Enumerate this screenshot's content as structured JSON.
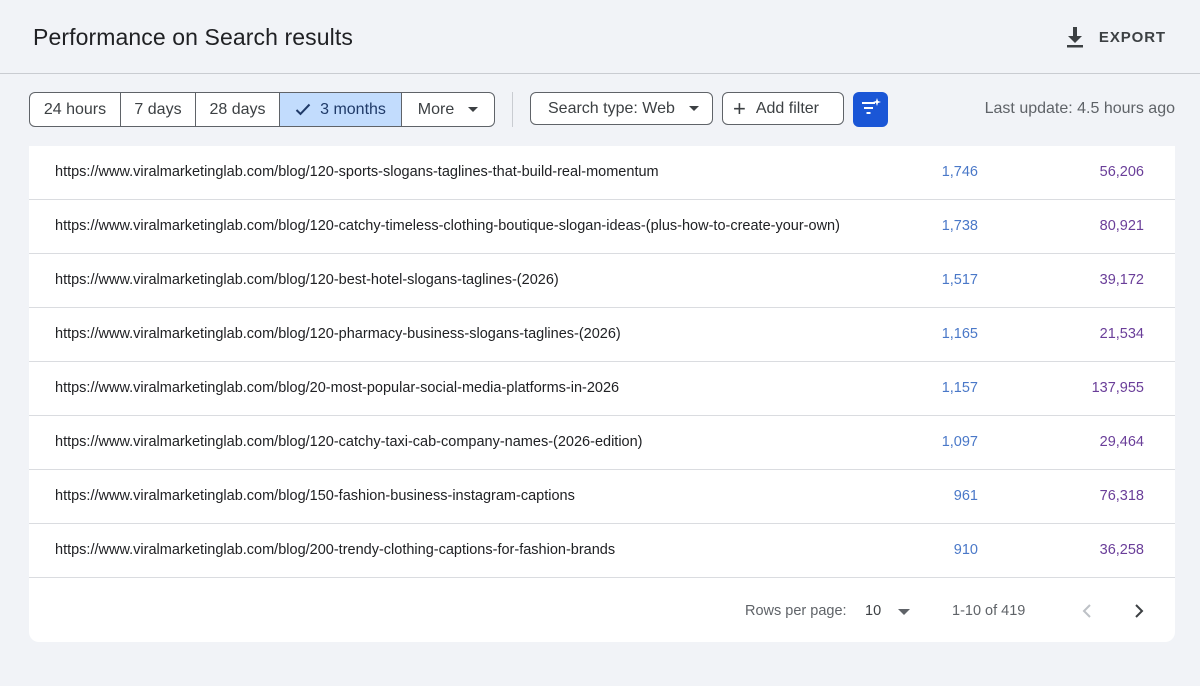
{
  "header": {
    "title": "Performance on Search results",
    "export_label": "EXPORT",
    "export_icon": "download-icon"
  },
  "date_ranges": [
    {
      "label": "24 hours",
      "selected": false
    },
    {
      "label": "7 days",
      "selected": false
    },
    {
      "label": "28 days",
      "selected": false
    },
    {
      "label": "3 months",
      "selected": true
    },
    {
      "label": "More",
      "selected": false
    }
  ],
  "filters": {
    "search_type_label": "Search type: Web",
    "add_filter_label": "Add filter",
    "filter_icon": "sparkle-filter-icon"
  },
  "last_update": "Last update: 4.5 hours ago",
  "rows": [
    {
      "url": "https://www.viralmarketinglab.com/blog/120-sports-slogans-taglines-that-build-real-momentum",
      "clicks": "1,746",
      "impressions": "56,206"
    },
    {
      "url": "https://www.viralmarketinglab.com/blog/120-catchy-timeless-clothing-boutique-slogan-ideas-(plus-how-to-create-your-own)",
      "clicks": "1,738",
      "impressions": "80,921"
    },
    {
      "url": "https://www.viralmarketinglab.com/blog/120-best-hotel-slogans-taglines-(2026)",
      "clicks": "1,517",
      "impressions": "39,172"
    },
    {
      "url": "https://www.viralmarketinglab.com/blog/120-pharmacy-business-slogans-taglines-(2026)",
      "clicks": "1,165",
      "impressions": "21,534"
    },
    {
      "url": "https://www.viralmarketinglab.com/blog/20-most-popular-social-media-platforms-in-2026",
      "clicks": "1,157",
      "impressions": "137,955"
    },
    {
      "url": "https://www.viralmarketinglab.com/blog/120-catchy-taxi-cab-company-names-(2026-edition)",
      "clicks": "1,097",
      "impressions": "29,464"
    },
    {
      "url": "https://www.viralmarketinglab.com/blog/150-fashion-business-instagram-captions",
      "clicks": "961",
      "impressions": "76,318"
    },
    {
      "url": "https://www.viralmarketinglab.com/blog/200-trendy-clothing-captions-for-fashion-brands",
      "clicks": "910",
      "impressions": "36,258"
    }
  ],
  "pagination": {
    "rows_per_page_label": "Rows per page:",
    "rows_per_page_value": "10",
    "range_label": "1-10 of 419"
  },
  "colors": {
    "clicks": "#4a78c8",
    "impressions": "#6a3e99",
    "selected_range_bg": "#c2dcfd",
    "accent_button": "#1a56d6"
  }
}
